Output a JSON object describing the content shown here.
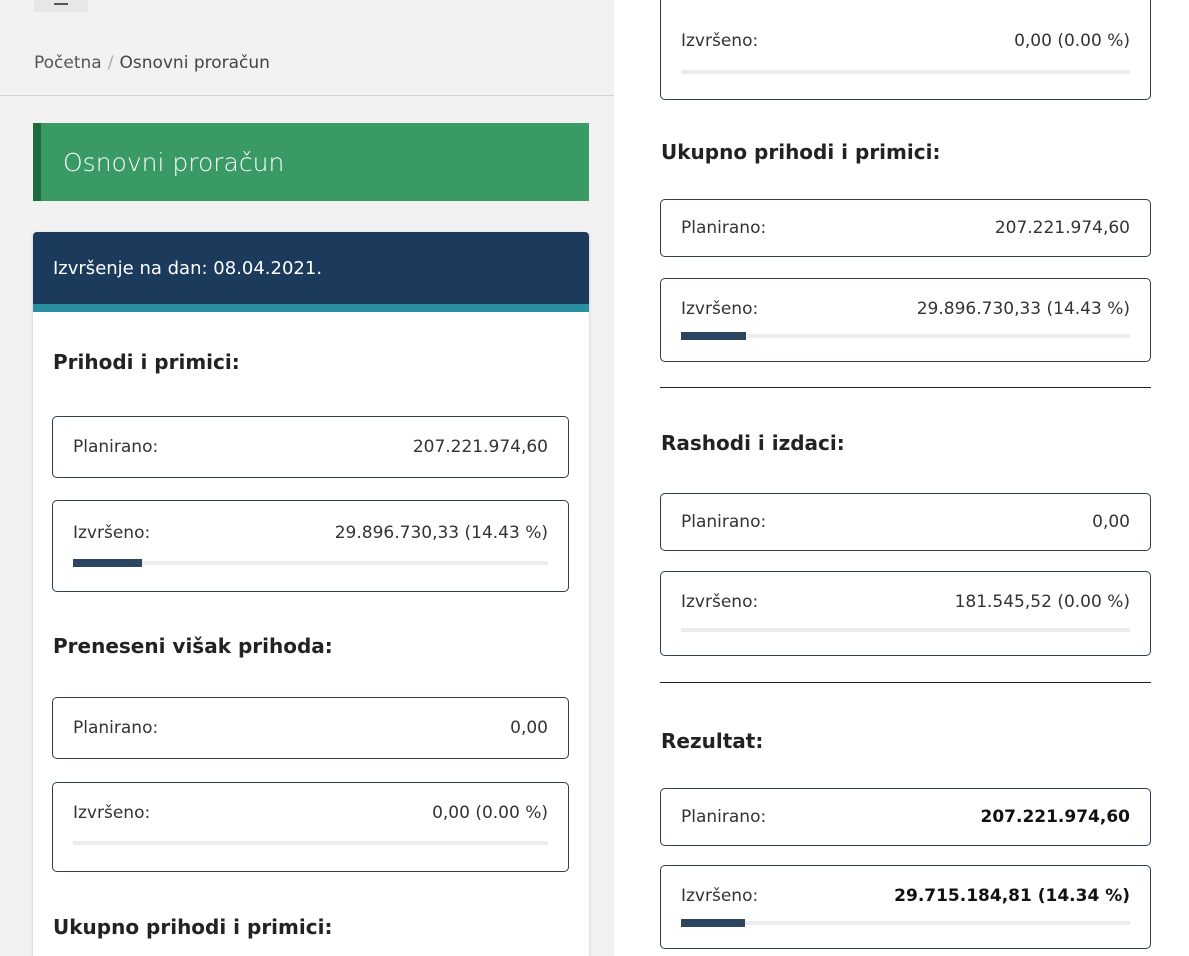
{
  "breadcrumb": {
    "home": "Početna",
    "separator": "/",
    "current": "Osnovni proračun"
  },
  "page_title": "Osnovni proračun",
  "card_header": "Izvršenje na dan: 08.04.2021.",
  "labels": {
    "planned": "Planirano:",
    "executed": "Izvršeno:"
  },
  "sections": {
    "prihodi": {
      "title": "Prihodi i primici:",
      "planned": "207.221.974,60",
      "executed": "29.896.730,33 (14.43 %)",
      "progress_pct": 14.43
    },
    "preneseni": {
      "title": "Preneseni višak prihoda:",
      "planned": "0,00",
      "executed": "0,00 (0.00 %)",
      "progress_pct": 0
    },
    "ukupno": {
      "title": "Ukupno prihodi i primici:",
      "planned": "207.221.974,60",
      "executed": "29.896.730,33 (14.43 %)",
      "progress_pct": 14.43
    },
    "rashodi": {
      "title": "Rashodi i izdaci:",
      "planned": "0,00",
      "executed": "181.545,52 (0.00 %)",
      "progress_pct": 0
    },
    "rezultat": {
      "title": "Rezultat:",
      "planned": "207.221.974,60",
      "executed": "29.715.184,81 (14.34 %)",
      "progress_pct": 14.34
    }
  },
  "colors": {
    "banner": "#3a9a66",
    "card_header": "#1b3a5c",
    "accent": "#2a8fa0",
    "progress": "#2c4560"
  }
}
